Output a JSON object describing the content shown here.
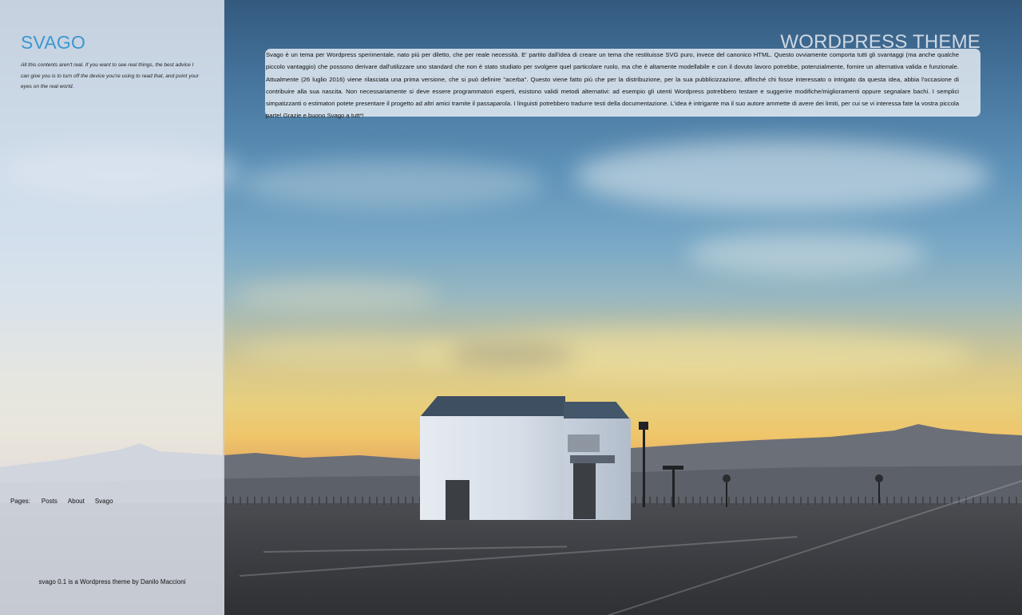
{
  "sidebar": {
    "site_title": "SVAGO",
    "tagline": "All this contents aren't real. If you want to see real things, the best advice I can give you is to turn off the device you're using to read that, and point your eyes on the real world.",
    "pages_label": "Pages:",
    "pages": [
      {
        "label": "Posts"
      },
      {
        "label": "About"
      },
      {
        "label": "Svago"
      }
    ],
    "footer": "svago 0.1 is a Wordpress theme by Danilo Maccioni"
  },
  "header": {
    "heading": "WORDPRESS THEME"
  },
  "post": {
    "body": "Svago è un tema per Wordpress sperimentale, nato più per diletto, che per reale necessità. E' partito dall'idea di creare un tema che restituisse SVG puro, invece del canonico HTML. Questo ovviamente comporta tutti gli svantaggi (ma anche qualche piccolo vantaggio) che possono derivare dall'utilizzare uno standard che non è stato studiato per svolgere quel particolare ruolo, ma che è altamente modellabile e con il dovuto lavoro potrebbe, potenzialmente, fornire un alternativa valida e funzionale. Attualmente (26 luglio 2016) viene rilasciata una prima versione, che si può definire \"acerba\". Questo viene fatto più che per la distribuzione, per la sua pubblicizzazione, affinché chi fosse interessato o intrigato da questa idea, abbia l'occasione di contribuire alla sua nascita. Non necessariamente si deve essere programmatori esperti, esistono validi metodi alternativi: ad esempio gli utenti Wordpress potrebbero testare e suggerire modifiche/miglioramenti oppure segnalare bachi. I semplici simpatizzanti o estimatori potete presentare il progetto ad altri amici tramite il passaparola. I linguisti potrebbero tradurre testi della documentazione. L'idea è intrigante ma il suo autore ammette di avere dei limiti, per cui se vi interessa fate la vostra piccola parte! Grazie e buono Svago a tutt*!"
  }
}
